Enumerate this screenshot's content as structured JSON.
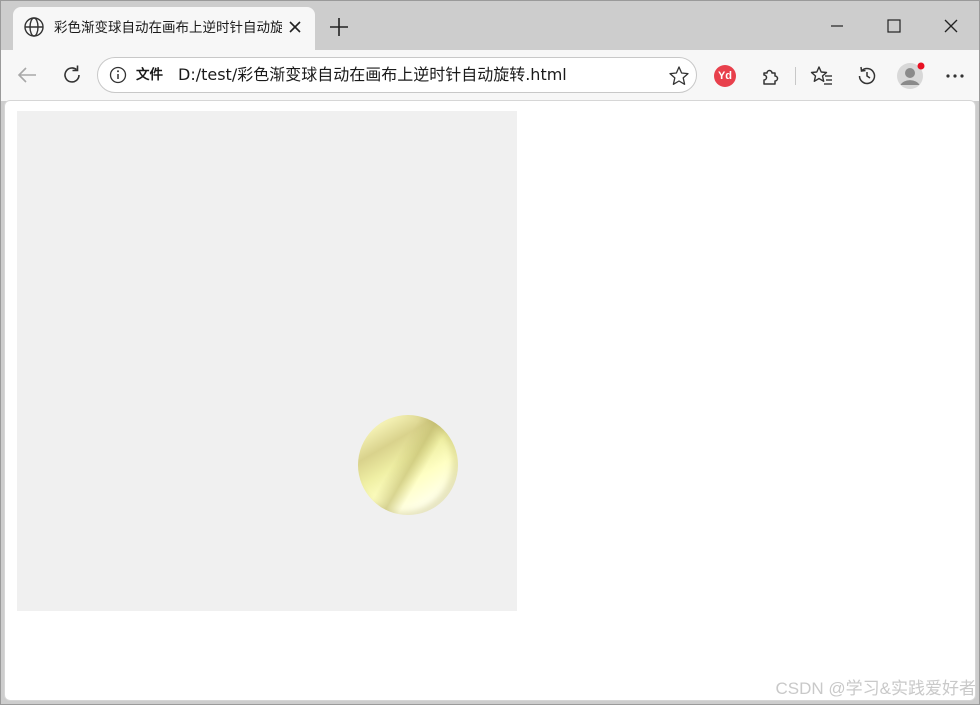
{
  "tab": {
    "title": "彩色渐变球自动在画布上逆时针自动旋转"
  },
  "address": {
    "scheme_label": "文件",
    "url": "D:/test/彩色渐变球自动在画布上逆时针自动旋转.html"
  },
  "extensions": {
    "youdao_label": "Yd"
  },
  "colors": {
    "canvas_bg": "#f0f0f0",
    "ball_light": "#ffffff",
    "ball_mid": "#ffffc4",
    "ball_dark": "#d9d28c",
    "profile_dot": "#e81123"
  },
  "watermark": "CSDN @学习&实践爱好者"
}
